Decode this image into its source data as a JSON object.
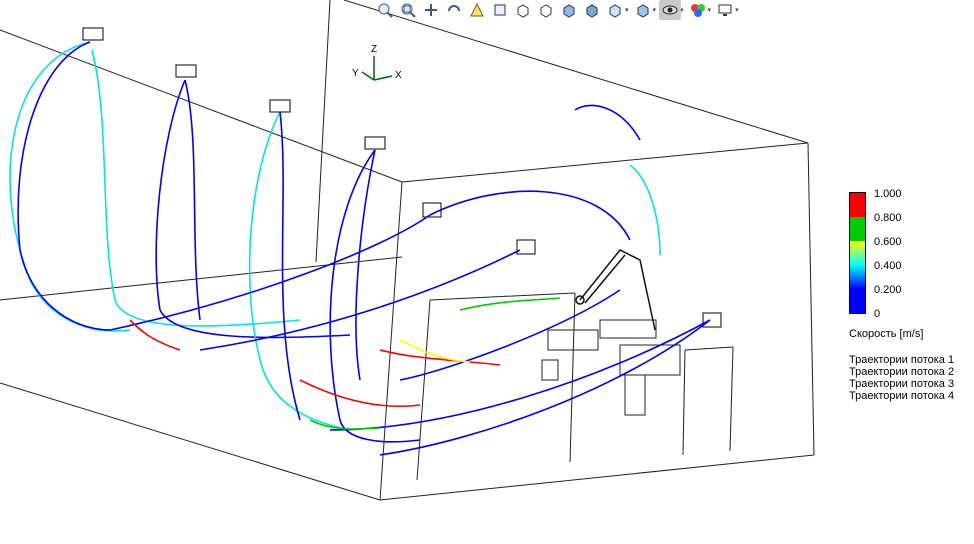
{
  "toolbar": {
    "buttons": [
      {
        "name": "zoom-to-fit-icon"
      },
      {
        "name": "zoom-to-area-icon"
      },
      {
        "name": "pan-icon"
      },
      {
        "name": "rotate-icon"
      },
      {
        "name": "view-orientation-icon"
      },
      {
        "name": "front-view-icon"
      },
      {
        "name": "top-view-icon"
      },
      {
        "name": "right-view-icon"
      },
      {
        "name": "isometric-view-icon"
      },
      {
        "name": "shaded-display-icon"
      },
      {
        "name": "display-style-icon"
      },
      {
        "name": "section-view-icon"
      },
      {
        "name": "hide-show-icon"
      },
      {
        "name": "appearance-icon"
      },
      {
        "name": "display-settings-icon"
      }
    ]
  },
  "triad": {
    "z": "Z",
    "y": "Y",
    "x": "X"
  },
  "legend": {
    "ticks": [
      "1.000",
      "0.800",
      "0.600",
      "0.400",
      "0.200",
      "0"
    ],
    "unit_label": "Скорость [m/s]",
    "trajectories": [
      "Траектории потока 1",
      "Траектории потока 2",
      "Траектории потока 3",
      "Траектории потока 4"
    ],
    "colors": [
      "#ff0000",
      "#00cc00",
      "#ffff00",
      "#00ffff",
      "#0000ff"
    ]
  }
}
